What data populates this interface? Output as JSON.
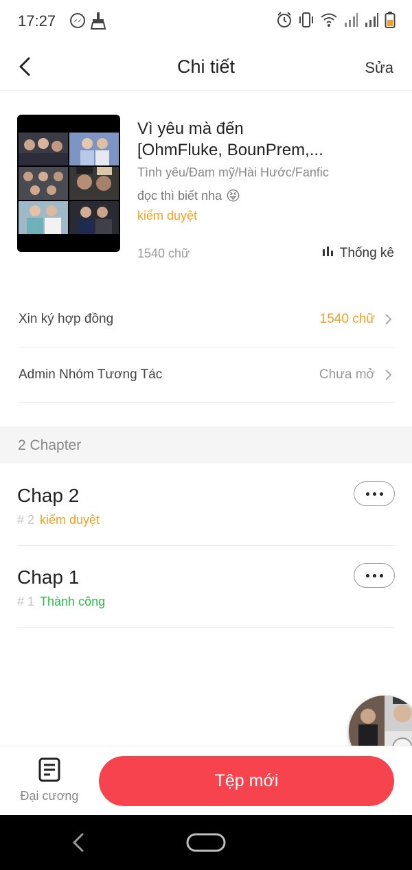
{
  "status_bar": {
    "time": "17:27",
    "left_icons": [
      "messenger-icon",
      "cleaner-icon"
    ],
    "right_icons": [
      "alarm-icon",
      "vibrate-icon",
      "wifi-icon",
      "signal-icon",
      "signal-icon",
      "battery-icon"
    ]
  },
  "header": {
    "title": "Chi tiết",
    "edit_label": "Sửa"
  },
  "book": {
    "title_line1": "Vì yêu mà đến",
    "title_line2": "[OhmFluke, BounPrem,...",
    "genre": "Tình yêu/Đam mỹ/Hài Hước/Fanfic",
    "description": "đọc thì biết nha",
    "description_emoji": "😝",
    "status": "kiểm duyệt",
    "word_count": "1540 chữ",
    "stats_label": "Thống kê"
  },
  "rows": [
    {
      "label": "Xin ký hợp đồng",
      "value": "1540 chữ",
      "value_color": "#f0a020"
    },
    {
      "label": "Admin Nhóm Tương Tác",
      "value": "Chưa mở",
      "value_color": "#999999"
    }
  ],
  "chapters_section": {
    "label": "2 Chapter"
  },
  "chapters": [
    {
      "name": "Chap 2",
      "number": "# 2",
      "status": "kiểm duyệt",
      "status_color": "#f0a020"
    },
    {
      "name": "Chap 1",
      "number": "# 1",
      "status": "Thành công",
      "status_color": "#2db84a"
    }
  ],
  "bottom_bar": {
    "outline_label": "Đại cương",
    "new_button_label": "Tệp mới"
  },
  "colors": {
    "accent_red": "#f7434d",
    "pending_orange": "#f0a020",
    "success_green": "#2db84a"
  }
}
